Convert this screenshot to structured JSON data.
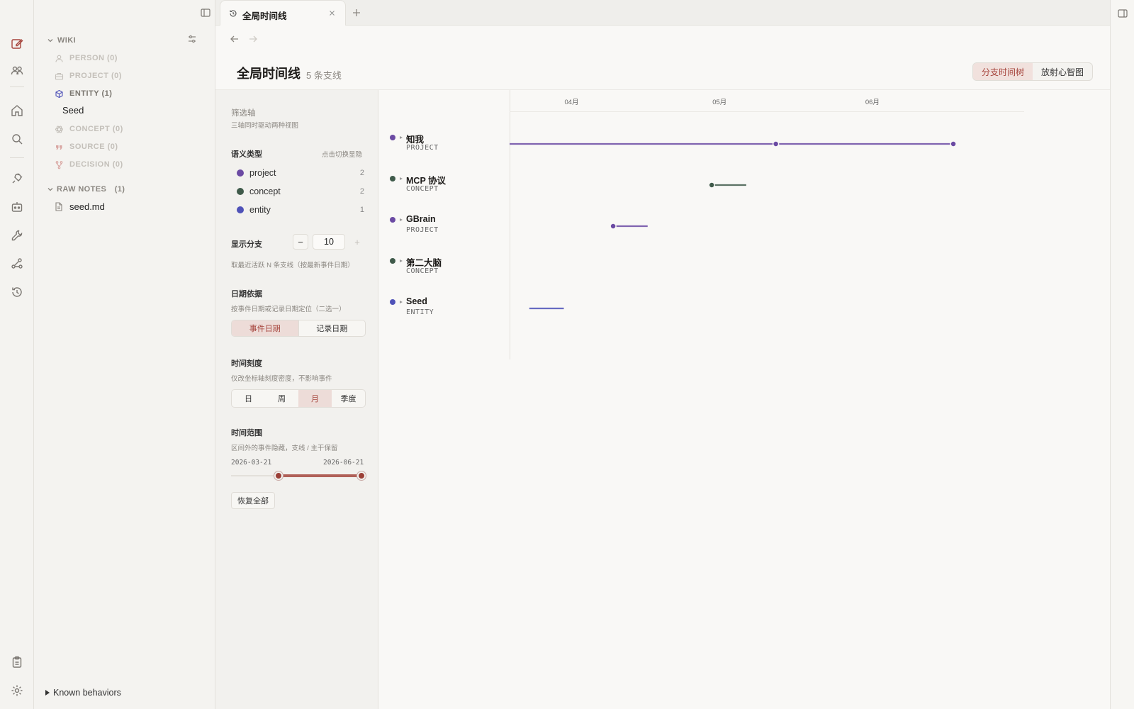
{
  "colors": {
    "accent": "#a6453d",
    "project": "#6b4aa3",
    "concept": "#3f5a4a",
    "entity": "#4f52b8"
  },
  "ribbon": {
    "icons": [
      "edit-icon",
      "people-icon",
      "home-icon",
      "search-icon",
      "plug-icon",
      "robot-icon",
      "wrench-icon",
      "graph-icon",
      "history-icon",
      "clipboard-icon",
      "settings-icon"
    ]
  },
  "sidebar": {
    "wiki_label": "WIKI",
    "items": [
      {
        "label": "PERSON (0)",
        "icon": "person-icon"
      },
      {
        "label": "PROJECT (0)",
        "icon": "briefcase-icon"
      },
      {
        "label": "ENTITY (1)",
        "icon": "cube-icon"
      },
      {
        "label": "CONCEPT (0)",
        "icon": "atom-icon"
      },
      {
        "label": "SOURCE (0)",
        "icon": "quote-icon"
      },
      {
        "label": "DECISION (0)",
        "icon": "fork-icon"
      }
    ],
    "entity_child": "Seed",
    "raw_notes_label": "RAW NOTES",
    "raw_notes_count": "(1)",
    "raw_file": "seed.md",
    "known_behaviors": "Known behaviors"
  },
  "tab": {
    "title": "全局时间线"
  },
  "header": {
    "title": "全局时间线",
    "subtitle": "5 条支线"
  },
  "view_toggle": {
    "tree": "分支时间树",
    "mindmap": "放射心智图",
    "selected": "tree"
  },
  "filter": {
    "axis_title": "筛选轴",
    "axis_desc": "三轴同时驱动两种视图",
    "semantic_label": "语义类型",
    "semantic_hint": "点击切换显隐",
    "semantic_types": [
      {
        "name": "project",
        "count": "2",
        "color": "#6b4aa3"
      },
      {
        "name": "concept",
        "count": "2",
        "color": "#3f5a4a"
      },
      {
        "name": "entity",
        "count": "1",
        "color": "#4f52b8"
      }
    ],
    "branches_label": "显示分支",
    "branches_minus": "−",
    "branches_value": "10",
    "branches_plus": "+",
    "branches_desc": "取最近活跃 N 条支线（按最新事件日期）",
    "date_basis_label": "日期依据",
    "date_basis_desc": "按事件日期或记录日期定位（二选一）",
    "date_event": "事件日期",
    "date_record": "记录日期",
    "scale_label": "时间刻度",
    "scale_desc": "仅改坐标轴刻度密度，不影响事件",
    "scale_options": [
      "日",
      "周",
      "月",
      "季度"
    ],
    "scale_selected": "月",
    "range_label": "时间范围",
    "range_desc": "区间外的事件隐藏，支线 / 主干保留",
    "range_start": "2026-03-21",
    "range_end": "2026-06-21",
    "range_low_frac": 0.34,
    "range_high_frac": 1.0,
    "reset_label": "恢复全部"
  },
  "timeline": {
    "months": [
      "04月",
      "05月",
      "06月"
    ],
    "branches": [
      {
        "name": "知我",
        "type": "PROJECT",
        "color": "#6b4aa3",
        "events": [
          "2026-03-21",
          "2026-05-14",
          "2026-06-19"
        ]
      },
      {
        "name": "MCP 协议",
        "type": "CONCEPT",
        "color": "#3f5a4a",
        "events": [
          "2026-05-01",
          "2026-05-08"
        ]
      },
      {
        "name": "GBrain",
        "type": "PROJECT",
        "color": "#6b4aa3",
        "events": [
          "2026-04-11",
          "2026-04-18"
        ]
      },
      {
        "name": "第二大脑",
        "type": "CONCEPT",
        "color": "#3f5a4a",
        "events": []
      },
      {
        "name": "Seed",
        "type": "ENTITY",
        "color": "#4f52b8",
        "events": [
          "2026-03-25",
          "2026-04-01"
        ]
      }
    ]
  }
}
